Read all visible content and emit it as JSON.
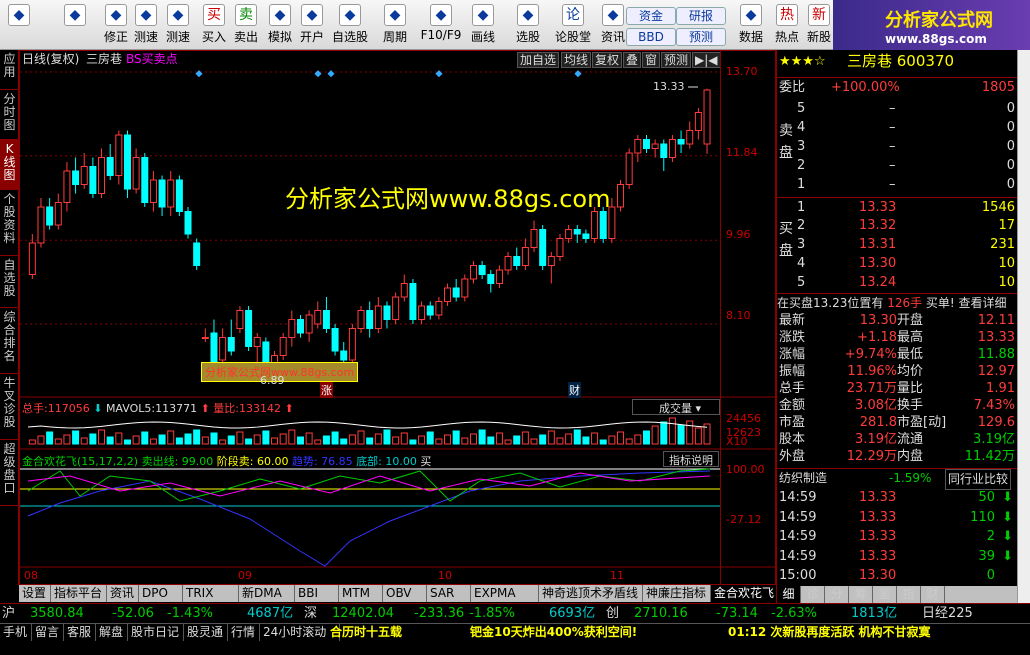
{
  "toolbar": {
    "items": [
      {
        "label": "",
        "icon": "app-grid-icon"
      },
      {
        "label": "",
        "icon": "back-arrow-icon"
      },
      {
        "label": "修正",
        "icon": "up-down-icon"
      },
      {
        "label": "测速",
        "icon": "dial-icon"
      },
      {
        "label": "测速",
        "icon": "clock-icon"
      },
      {
        "label": "买入",
        "icon": "buy-icon"
      },
      {
        "label": "卖出",
        "icon": "sell-icon"
      },
      {
        "label": "模拟",
        "icon": "hammer-icon"
      },
      {
        "label": "开户",
        "icon": "lock-icon"
      },
      {
        "label": "自选股",
        "icon": "star-icon"
      },
      {
        "label": "周期",
        "icon": "period-icon"
      },
      {
        "label": "F10/F9",
        "icon": "f10-icon"
      },
      {
        "label": "画线",
        "icon": "pen-icon"
      },
      {
        "label": "选股",
        "icon": "chart-select-icon"
      },
      {
        "label": "论股堂",
        "icon": "forum-icon"
      },
      {
        "label": "资讯",
        "icon": "news-icon"
      },
      {
        "label": "数据",
        "icon": "data-icon"
      },
      {
        "label": "热点",
        "icon": "hot-icon"
      },
      {
        "label": "新股",
        "icon": "new-icon"
      }
    ],
    "buttons": [
      "资金",
      "研报",
      "BBD",
      "预测"
    ],
    "logo_text": "分析家公式网",
    "logo_url": "www.88gs.com"
  },
  "left_tabs": [
    "应用",
    "分时图",
    "K线图",
    "个股资料",
    "自选股",
    "综合排名",
    "牛叉诊股",
    "超级盘口"
  ],
  "chart_header": {
    "title": "日线(复权)",
    "stock": "三房巷",
    "indicator": "BS买卖点",
    "buttons": [
      "加自选",
      "均线",
      "复权",
      "叠",
      "窗",
      "预测"
    ]
  },
  "price_axis": [
    "13.70",
    "11.84",
    "9.96",
    "8.10"
  ],
  "high_label": "13.33",
  "low_label": "6.89",
  "watermark": "分析家公式网www.88gs.com",
  "watermark_small": "分析家公式网www.88gs.com",
  "markers": [
    "涨",
    "财"
  ],
  "volume": {
    "label1": "总手:",
    "v1": "117056",
    "label2": "MAVOL5:",
    "v2": "113771",
    "label3": "量比:",
    "v3": "133142",
    "dropdown": "成交量",
    "axis": [
      "24456",
      "12623",
      "X10"
    ]
  },
  "indicator": {
    "name": "金合欢花飞(15,17,2,2)",
    "sell": "卖出线: 99.00",
    "stage": "阶段卖: 60.00",
    "trend": "趋势: 76.85",
    "bottom": "底部: 10.00",
    "buy": "买",
    "explain": "指标说明",
    "axis": [
      "100.00",
      "-27.12"
    ]
  },
  "x_axis": [
    "08",
    "09",
    "10",
    "11"
  ],
  "bottom_tabs": [
    "设置",
    "指标平台",
    "资讯",
    "DPO",
    "TRIX",
    "新DMA",
    "BBI",
    "MTM",
    "OBV",
    "SAR",
    "EXPMA",
    "神奇逃顶术矛盾线",
    "神廉庄指标",
    "金合欢花飞"
  ],
  "side": {
    "title": "三房巷 600370",
    "ratio_label": "委比",
    "ratio": "+100.00%",
    "ratio_val": "1805",
    "sell": [
      {
        "n": "5",
        "p": "–",
        "v": "0"
      },
      {
        "n": "4",
        "p": "–",
        "v": "0"
      },
      {
        "n": "3",
        "p": "–",
        "v": "0"
      },
      {
        "n": "2",
        "p": "–",
        "v": "0"
      },
      {
        "n": "1",
        "p": "–",
        "v": "0"
      }
    ],
    "buy": [
      {
        "n": "1",
        "p": "13.33",
        "v": "1546"
      },
      {
        "n": "2",
        "p": "13.32",
        "v": "17"
      },
      {
        "n": "3",
        "p": "13.31",
        "v": "231"
      },
      {
        "n": "4",
        "p": "13.30",
        "v": "10"
      },
      {
        "n": "5",
        "p": "13.24",
        "v": "10"
      }
    ],
    "sell_side": "卖盘",
    "buy_side": "买盘",
    "notice": "在买盘13.23位置有",
    "notice_v": "126手",
    "notice2": "买单! 查看详细",
    "stats": [
      [
        "最新",
        "13.30",
        "开盘",
        "12.11"
      ],
      [
        "涨跌",
        "+1.18",
        "最高",
        "13.33"
      ],
      [
        "涨幅",
        "+9.74%",
        "最低",
        "11.88"
      ],
      [
        "振幅",
        "11.96%",
        "均价",
        "12.97"
      ],
      [
        "总手",
        "23.71万",
        "量比",
        "1.91"
      ],
      [
        "金额",
        "3.08亿",
        "换手",
        "7.43%"
      ],
      [
        "市盈",
        "281.8",
        "市盈[动]",
        "129.6"
      ],
      [
        "股本",
        "3.19亿",
        "流通",
        "3.19亿"
      ],
      [
        "外盘",
        "12.29万",
        "内盘",
        "11.42万"
      ]
    ],
    "industry": "纺织制造",
    "industry_pct": "-1.59%",
    "compare": "同行业比较",
    "ticks": [
      [
        "14:59",
        "13.33",
        "50"
      ],
      [
        "14:59",
        "13.33",
        "110"
      ],
      [
        "14:59",
        "13.33",
        "2"
      ],
      [
        "14:59",
        "13.33",
        "39"
      ],
      [
        "15:00",
        "13.30",
        "0"
      ]
    ],
    "tabs": [
      "细",
      "诊",
      "分",
      "筹",
      "鉴",
      "指",
      "财"
    ]
  },
  "status1": [
    [
      "沪",
      "3580.84",
      "-52.06",
      "-1.43%",
      "4687亿"
    ],
    [
      "深",
      "12402.04",
      "-233.36",
      "-1.85%",
      "6693亿"
    ],
    [
      "创",
      "2710.16",
      "-73.14",
      "-2.63%",
      "1813亿"
    ]
  ],
  "status1_extra": "日经225",
  "status2": [
    "手机",
    "留言",
    "客服",
    "解盘",
    "股市日记",
    "股灵通",
    "行情",
    "24小时滚动"
  ],
  "news": [
    "合历时十五载",
    "钯金10天炸出400%获利空间!",
    "01:12 次新股再度活跃 机构不甘寂寞"
  ]
}
